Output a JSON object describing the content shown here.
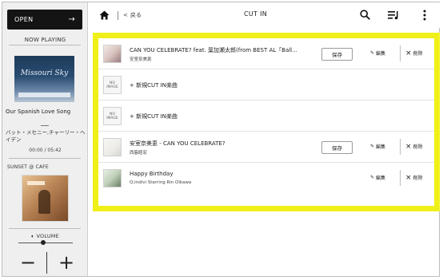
{
  "sidebar": {
    "open_label": "OPEN",
    "now_playing_label": "NOW PLAYING",
    "cover_title": "Missouri Sky",
    "song_title": "Our Spanish Love Song",
    "artist": "バット・メセニー,チャーリー・ヘイデン",
    "time": "00:00 / 05:42",
    "playlist_name": "SUNSET @ CAFE",
    "volume_label": "VOLUME",
    "volume_level": 0.45
  },
  "topbar": {
    "back_label": "戻る",
    "title": "CUT IN"
  },
  "rows": [
    {
      "type": "track",
      "title": "CAN YOU CELEBRATE? feat. 葉加瀬太郎(from BEST AL「Ball...",
      "artist": "安室奈美恵",
      "save_label": "保存",
      "edit_label": "編集",
      "delete_label": "削除"
    },
    {
      "type": "add",
      "noimage_label": "NO IMAGE",
      "add_label": "+ 新規CUT IN楽曲"
    },
    {
      "type": "add",
      "noimage_label": "NO IMAGE",
      "add_label": "+ 新規CUT IN楽曲"
    },
    {
      "type": "track",
      "title": "安室奈美恵 - CAN YOU CELEBRATE?",
      "artist": "西脇睦宏",
      "save_label": "保存",
      "edit_label": "編集",
      "delete_label": "削除"
    },
    {
      "type": "track",
      "title": "Happy Birthday",
      "artist": "Q;indivi Starring Rin Oikawa",
      "edit_label": "編集",
      "delete_label": "削除"
    }
  ],
  "colors": {
    "highlight": "#eff019",
    "open_button": "#141414"
  },
  "icons": [
    "home-icon",
    "back-chevron-icon",
    "search-icon",
    "queue-icon",
    "more-vert-icon",
    "arrow-right-icon",
    "volume-icon",
    "pencil-icon",
    "close-icon"
  ]
}
